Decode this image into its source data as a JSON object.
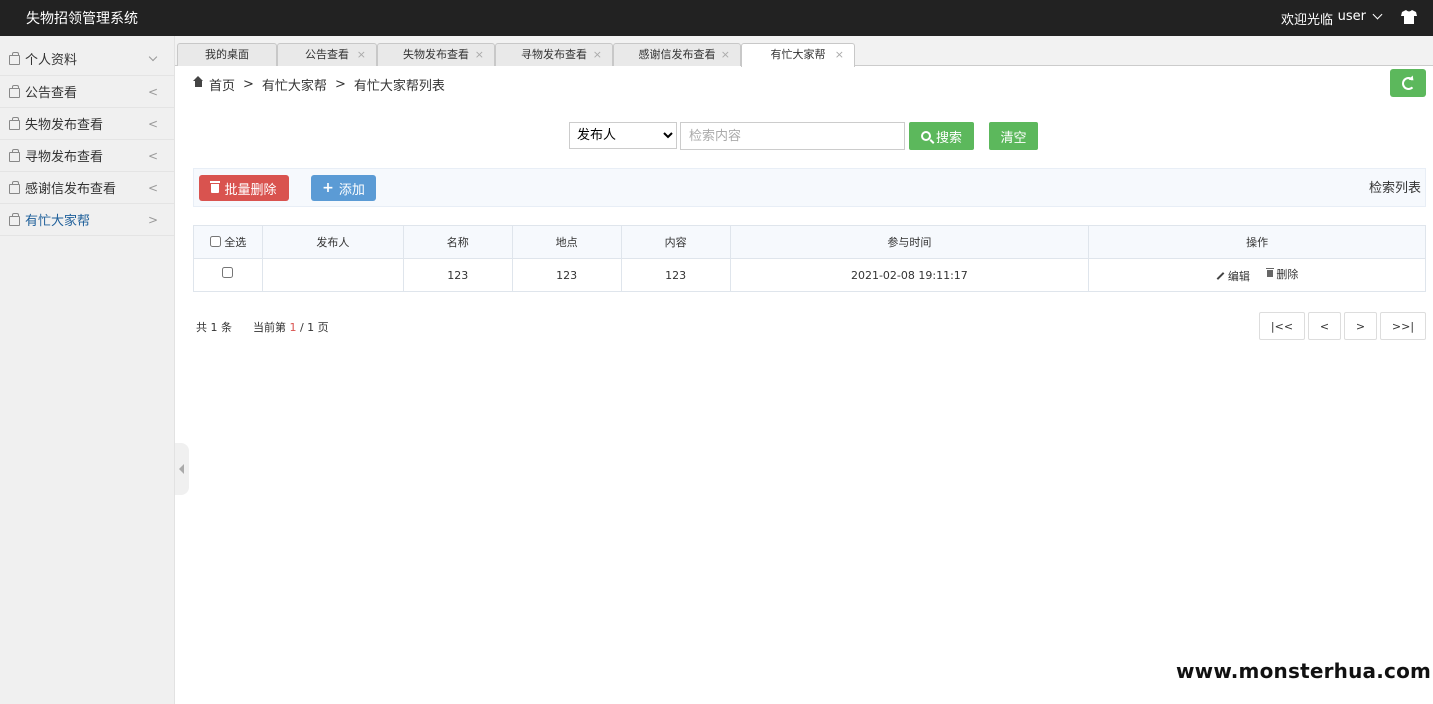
{
  "header": {
    "title": "失物招领管理系统",
    "welcome": "欢迎光临",
    "user": "user",
    "icons": {
      "user_menu": "chevron-down-icon",
      "theme": "tshirt-icon"
    }
  },
  "sidebar": {
    "items": [
      {
        "label": "个人资料",
        "arrow": "∨"
      },
      {
        "label": "公告查看",
        "arrow": "<"
      },
      {
        "label": "失物发布查看",
        "arrow": "<"
      },
      {
        "label": "寻物发布查看",
        "arrow": "<"
      },
      {
        "label": "感谢信发布查看",
        "arrow": "<"
      },
      {
        "label": "有忙大家帮",
        "arrow": ">"
      }
    ],
    "active_color": "#1e5f9a"
  },
  "tabs": [
    {
      "label": "我的桌面"
    },
    {
      "label": "公告查看",
      "close": "×"
    },
    {
      "label": "失物发布查看",
      "close": "×"
    },
    {
      "label": "寻物发布查看",
      "close": "×"
    },
    {
      "label": "感谢信发布查看",
      "close": "×"
    },
    {
      "label": "有忙大家帮",
      "close": "×"
    }
  ],
  "breadcrumb": {
    "home": "首页",
    "sep": ">",
    "level1": "有忙大家帮",
    "level2": "有忙大家帮列表"
  },
  "search": {
    "field_selected": "发布人",
    "placeholder": "检索内容",
    "search_label": "搜索",
    "clear_label": "清空"
  },
  "toolbar": {
    "batch_delete_label": "批量删除",
    "add_label": "添加",
    "right_label": "检索列表"
  },
  "table": {
    "columns": [
      "全选",
      "发布人",
      "名称",
      "地点",
      "内容",
      "参与时间",
      "操作"
    ],
    "rows": [
      {
        "publisher": "",
        "name": "123",
        "place": "123",
        "content": "123",
        "time": "2021-02-08 19:11:17",
        "edit_label": "编辑",
        "delete_label": "删除"
      }
    ]
  },
  "pagination": {
    "total_prefix": "共",
    "total": "1",
    "total_suffix": "条",
    "current_prefix": "当前第",
    "current": "1",
    "pages": "/ 1 页",
    "first": "|<<",
    "prev": "<",
    "next": ">",
    "last": ">>|"
  },
  "watermark": "www.monsterhua.com",
  "colors": {
    "header_bg": "#222222",
    "success": "#5cb85c",
    "danger": "#d9534f",
    "primary": "#5b9bd5"
  }
}
